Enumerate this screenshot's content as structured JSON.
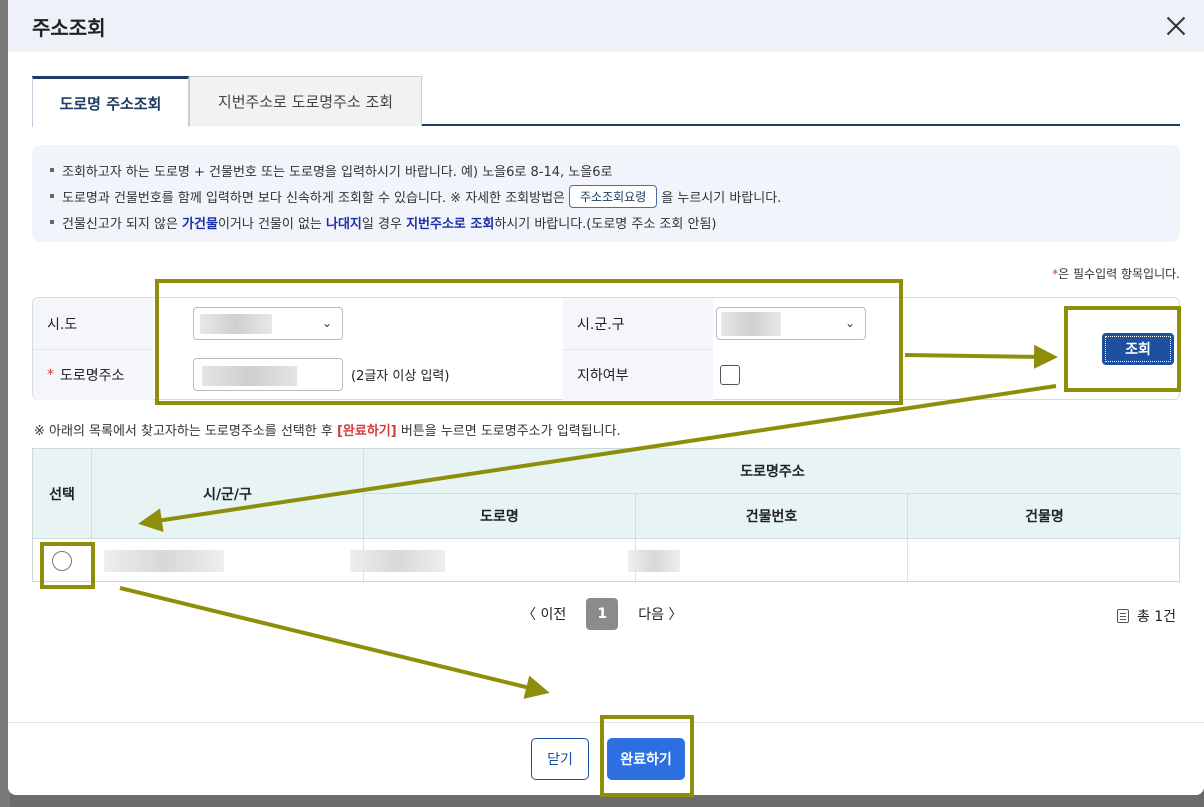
{
  "modal": {
    "title": "주소조회"
  },
  "tabs": [
    {
      "label": "도로명 주소조회",
      "active": true
    },
    {
      "label": "지번주소로 도로명주소 조회",
      "active": false
    }
  ],
  "info": {
    "line1": "조회하고자 하는 도로명 + 건물번호 또는 도로명을 입력하시기 바랍니다. 예) 노을6로 8-14, 노을6로",
    "line2_a": "도로명과 건물번호를 함께 입력하면 보다 신속하게 조회할 수 있습니다. ※ 자세한 조회방법은",
    "guide_button": "주소조회요령",
    "line2_b": "을 누르시기 바랍니다.",
    "line3_a": "건물신고가 되지 않은 ",
    "line3_hl1": "가건물",
    "line3_b": "이거나 건물이 없는 ",
    "line3_hl2": "나대지",
    "line3_c": "일 경우 ",
    "line3_hl3": "지번주소로 조회",
    "line3_d": "하시기 바랍니다.(도로명 주소 조회 안됨)"
  },
  "required_note": {
    "star": "*",
    "text": "은 필수입력 항목입니다."
  },
  "form": {
    "sido_label": "시.도",
    "sigungu_label": "시.군.구",
    "road_label": "도로명주소",
    "road_required": "*",
    "road_hint": "(2글자 이상 입력)",
    "underground_label": "지하여부",
    "search_button": "조회"
  },
  "notice": {
    "a": "※ 아래의 목록에서 찾고자하는 도로명주소를 선택한 후 ",
    "red": "[완료하기]",
    "b": " 버튼을 누르면 도로명주소가 입력됩니다."
  },
  "table": {
    "headers": {
      "select": "선택",
      "sigungu": "시/군/구",
      "road_address": "도로명주소",
      "road_name": "도로명",
      "building_no": "건물번호",
      "building_name": "건물명"
    }
  },
  "pager": {
    "prev": "〈 이전",
    "current": "1",
    "next": "다음 〉"
  },
  "total": {
    "text": "총 1건"
  },
  "footer": {
    "close": "닫기",
    "done": "완료하기"
  }
}
